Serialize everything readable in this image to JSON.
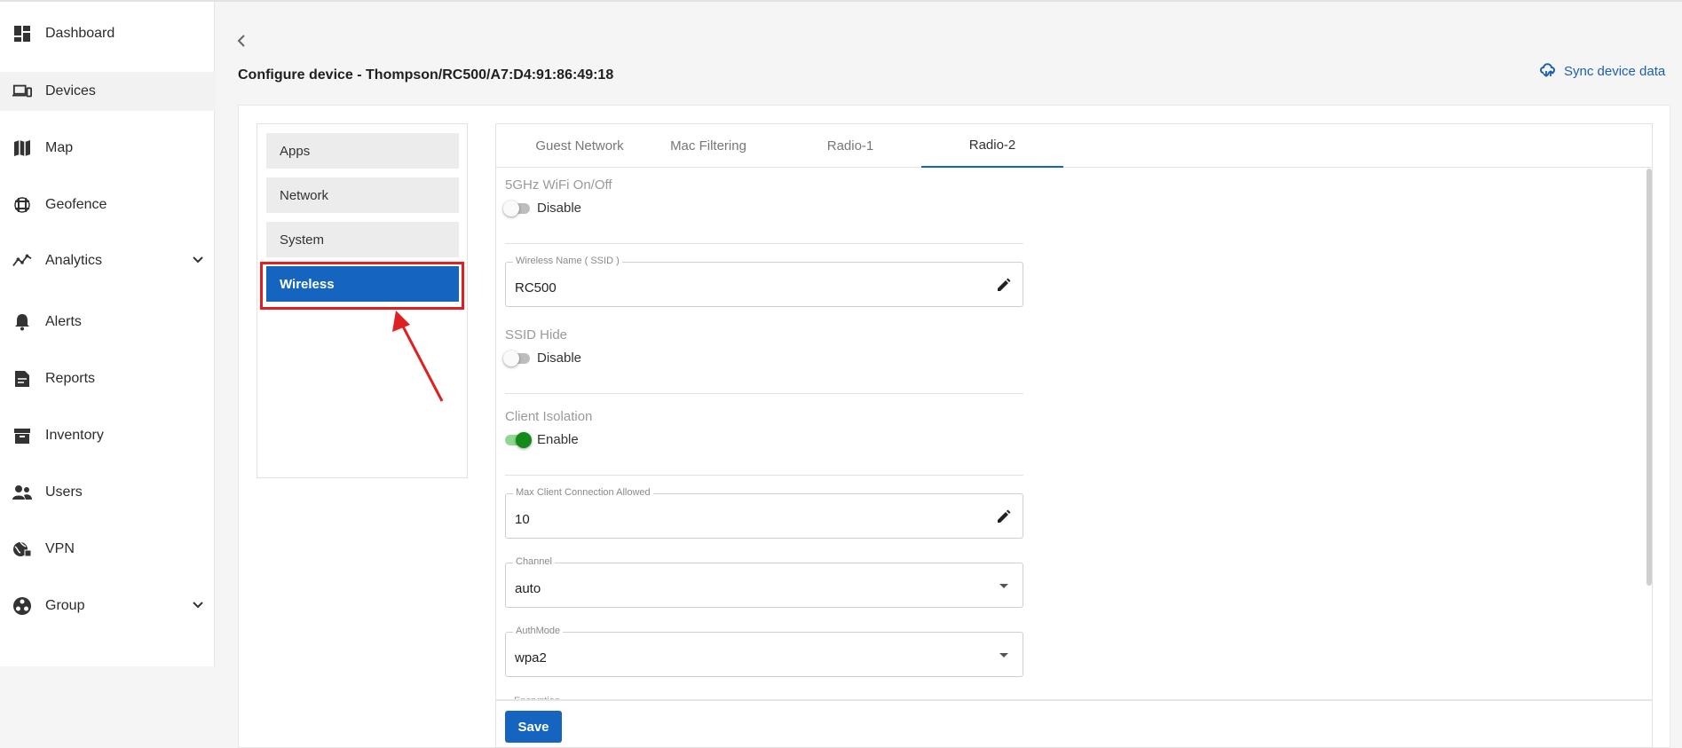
{
  "sidebar": {
    "items": [
      {
        "label": "Dashboard",
        "icon": "dashboard-icon"
      },
      {
        "label": "Devices",
        "icon": "devices-icon",
        "active": true
      },
      {
        "label": "Map",
        "icon": "map-icon"
      },
      {
        "label": "Geofence",
        "icon": "geofence-icon"
      },
      {
        "label": "Analytics",
        "icon": "analytics-icon",
        "expandable": true
      },
      {
        "label": "Alerts",
        "icon": "bell-icon"
      },
      {
        "label": "Reports",
        "icon": "reports-icon"
      },
      {
        "label": "Inventory",
        "icon": "inventory-icon"
      },
      {
        "label": "Users",
        "icon": "users-icon"
      },
      {
        "label": "VPN",
        "icon": "vpn-icon"
      },
      {
        "label": "Group",
        "icon": "group-icon",
        "expandable": true
      }
    ]
  },
  "header": {
    "title": "Configure device - Thompson/RC500/A7:D4:91:86:49:18",
    "sync_label": "Sync device data"
  },
  "config_menu": {
    "items": [
      "Apps",
      "Network",
      "System",
      "Wireless"
    ],
    "selected": "Wireless"
  },
  "tabs": {
    "items": [
      "Guest Network",
      "Mac Filtering",
      "Radio-1",
      "Radio-2"
    ],
    "active": "Radio-2"
  },
  "form": {
    "wifi_toggle": {
      "label": "5GHz WiFi On/Off",
      "state_label": "Disable",
      "on": false
    },
    "ssid": {
      "legend": "Wireless Name ( SSID )",
      "value": "RC500"
    },
    "ssid_hide": {
      "label": "SSID Hide",
      "state_label": "Disable",
      "on": false
    },
    "client_isolation": {
      "label": "Client Isolation",
      "state_label": "Enable",
      "on": true
    },
    "max_clients": {
      "legend": "Max Client Connection Allowed",
      "value": "10"
    },
    "channel": {
      "legend": "Channel",
      "value": "auto"
    },
    "authmode": {
      "legend": "AuthMode",
      "value": "wpa2"
    },
    "encryption_cut_label": "Encryption",
    "save_label": "Save"
  },
  "colors": {
    "accent": "#1565c0",
    "annotation": "#e02020",
    "toggle_on": "#138a1a"
  }
}
